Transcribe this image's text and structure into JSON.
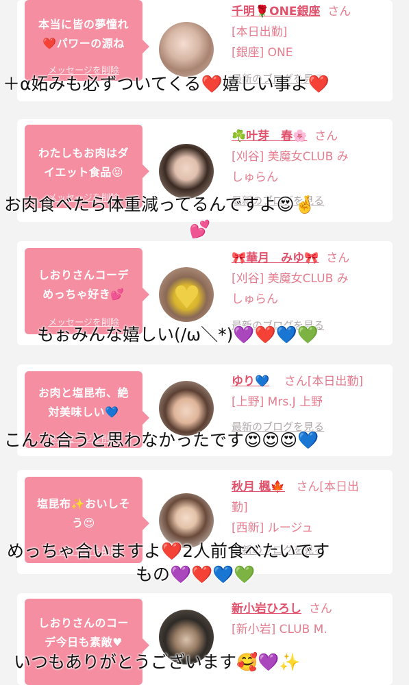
{
  "cards": [
    {
      "bubble": "本当に皆の夢憧れ❤️パワーの源ね",
      "delete": "メッセージを削除",
      "name": "千明🌹ONE銀座",
      "san": "さん",
      "lines": [
        "[本日出勤]",
        "[銀座] ONE"
      ],
      "blog": "最新のブログを見る"
    },
    {
      "bubble": "わたしもお肉はダイエット食品😝",
      "delete": "メッセージを削除",
      "name": "☘️叶芽　春🌸",
      "san": "さん",
      "lines": [
        "[刈谷] 美魔女CLUB み",
        "しゅらん"
      ],
      "blog": "最新のブログを見る"
    },
    {
      "bubble": "しおりさんコーデめっちゃ好き💕",
      "delete": "メッセージを削除",
      "name": "🎀華月　みゆ🎀",
      "san": "さん",
      "lines": [
        "[刈谷] 美魔女CLUB み",
        "しゅらん"
      ],
      "blog": "最新のブログを見る"
    },
    {
      "bubble": "お肉と塩昆布、絶対美味しい💙",
      "delete": "メッセージを削除",
      "name": "ゆり💙",
      "san": "さん[本日出勤]",
      "lines": [
        "[上野] Mrs.J 上野"
      ],
      "blog": "最新のブログを見る"
    },
    {
      "bubble": "塩昆布✨おいしそう😍",
      "delete": "メッセージを削除",
      "name": "秋月 楓🍁",
      "san": "さん[本日出",
      "lines": [
        "勤]",
        "[西新] ルージュ"
      ],
      "blog": "最新のブログを見る"
    },
    {
      "bubble": "しおりさんのコーデ今日も素敵♥",
      "delete": "",
      "name": "新小岩ひろし",
      "san": "さん",
      "lines": [
        "[新小岩] CLUB M."
      ],
      "blog": ""
    }
  ],
  "comments": [
    "＋α妬みも必ずついてくる❤️嬉しい事よ❤️",
    "お肉食べたら体重減ってるんですよ😍🤞",
    "💕",
    "もぉみんな嬉しい(/ω＼*)💜❤️💙💚",
    "こんな合うと思わなかったです😍😍😍💙",
    "めっちゃ合いますよ❤️2人前食べたいです",
    "もの💜❤️💙💚",
    "いつもありがとうございます🥰💜✨"
  ]
}
